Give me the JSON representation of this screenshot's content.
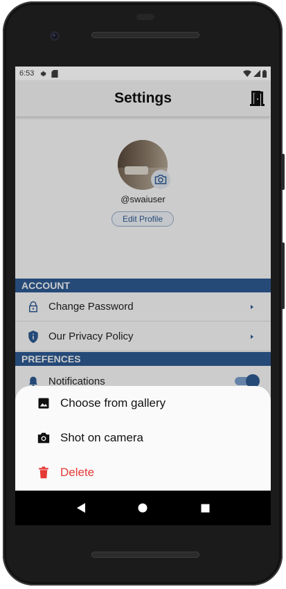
{
  "status_bar": {
    "time": "6:53",
    "icons": [
      "settings-gear-icon",
      "sd-card-icon",
      "wifi-icon",
      "signal-icon",
      "battery-icon"
    ]
  },
  "app_bar": {
    "title": "Settings",
    "action_icon": "logout-door-icon"
  },
  "profile": {
    "username": "@swaiuser",
    "edit_button_label": "Edit Profile",
    "avatar_badge_icon": "camera-icon"
  },
  "sections": [
    {
      "header": "ACCOUNT",
      "items": [
        {
          "label": "Change Password",
          "icon": "lock-icon"
        },
        {
          "label": "Our Privacy Policy",
          "icon": "shield-icon"
        }
      ]
    },
    {
      "header": "PREFENCES",
      "items": [
        {
          "label": "Notifications",
          "icon": "bell-icon",
          "toggle_on": true
        }
      ]
    }
  ],
  "bottom_sheet": {
    "items": [
      {
        "label": "Choose from gallery",
        "icon": "image-icon"
      },
      {
        "label": "Shot on camera",
        "icon": "camera-icon"
      },
      {
        "label": "Delete",
        "icon": "trash-icon"
      }
    ]
  },
  "colors": {
    "accent": "#2f5d96",
    "danger": "#e53935",
    "section_header_bg": "#2f5d96"
  },
  "nav_bar": {
    "icons": [
      "back-triangle-icon",
      "home-circle-icon",
      "recents-square-icon"
    ]
  }
}
